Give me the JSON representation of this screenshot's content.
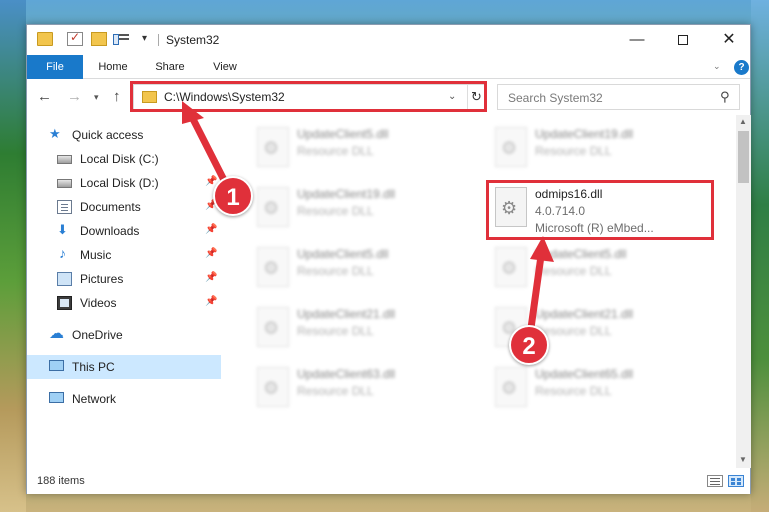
{
  "window": {
    "title": "System32",
    "controls": {
      "minimize": "—",
      "close": "✕"
    }
  },
  "ribbon": {
    "tabs": [
      "File",
      "Home",
      "Share",
      "View"
    ],
    "help": "?"
  },
  "address": {
    "path": "C:\\Windows\\System32",
    "search_placeholder": "Search System32"
  },
  "nav_pane": {
    "quick_access": "Quick access",
    "items": [
      {
        "label": "Local Disk (C:)",
        "icon": "disk-icon"
      },
      {
        "label": "Local Disk (D:)",
        "icon": "disk-icon"
      },
      {
        "label": "Documents",
        "icon": "documents-icon"
      },
      {
        "label": "Downloads",
        "icon": "download-icon"
      },
      {
        "label": "Music",
        "icon": "music-icon"
      },
      {
        "label": "Pictures",
        "icon": "pictures-icon"
      },
      {
        "label": "Videos",
        "icon": "videos-icon"
      }
    ],
    "onedrive": "OneDrive",
    "this_pc": "This PC",
    "network": "Network"
  },
  "files": [
    {
      "name": "UpdateClient5.dll",
      "desc": "Resource DLL"
    },
    {
      "name": "UpdateClient19.dll",
      "desc": "Resource DLL"
    },
    {
      "name": "UpdateClient19.dll",
      "desc": "Resource DLL"
    },
    {
      "name": "odmips16.dll",
      "version": "4.0.714.0",
      "desc": "Microsoft (R) eMbed..."
    },
    {
      "name": "UpdateClient5.dll",
      "desc": "Resource DLL"
    },
    {
      "name": "UpdateClient5.dll",
      "desc": "Resource DLL"
    },
    {
      "name": "UpdateClient21.dll",
      "desc": "Resource DLL"
    },
    {
      "name": "UpdateClient21.dll",
      "desc": "Resource DLL"
    },
    {
      "name": "UpdateClient63.dll",
      "desc": "Resource DLL"
    },
    {
      "name": "UpdateClient65.dll",
      "desc": "Resource DLL"
    }
  ],
  "status": {
    "items": "188 items"
  },
  "callouts": [
    "1",
    "2"
  ],
  "colors": {
    "accent": "#1979ca",
    "highlight": "#e0303a",
    "selection": "#cce8ff"
  }
}
